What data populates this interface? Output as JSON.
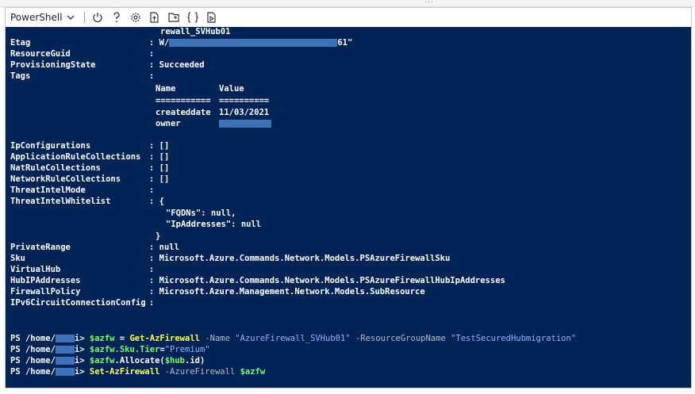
{
  "toolbar": {
    "shell": "PowerShell",
    "icons": [
      "chevron-down-icon",
      "power-icon",
      "help-icon",
      "gear-icon",
      "upload-download-icon",
      "open-editor-icon",
      "braces-icon",
      "web-preview-icon"
    ]
  },
  "console": {
    "prefix_line": "rewall_SVHub01",
    "props_top": [
      {
        "key": "Etag",
        "value": "W/",
        "value_tail": "61\""
      },
      {
        "key": "ResourceGuid",
        "value": ""
      },
      {
        "key": "ProvisioningState",
        "value": "Succeeded"
      },
      {
        "key": "Tags",
        "value": ""
      }
    ],
    "tags_table": {
      "headers": [
        "Name",
        "Value"
      ],
      "underline": [
        "===========",
        "=========="
      ],
      "rows": [
        {
          "name": "createddate",
          "value": "11/03/2021"
        },
        {
          "name": "owner",
          "value": ""
        }
      ]
    },
    "props_mid": [
      {
        "key": "IpConfigurations",
        "value": "[]"
      },
      {
        "key": "ApplicationRuleCollections",
        "value": "[]"
      },
      {
        "key": "NatRuleCollections",
        "value": "[]"
      },
      {
        "key": "NetworkRuleCollections",
        "value": "[]"
      },
      {
        "key": "ThreatIntelMode",
        "value": ""
      },
      {
        "key": "ThreatIntelWhitelist",
        "value": "{"
      }
    ],
    "json_block": [
      "\"FQDNs\": null,",
      "\"IpAddresses\": null",
      "}"
    ],
    "props_bottom": [
      {
        "key": "PrivateRange",
        "value": "null"
      },
      {
        "key": "Sku",
        "value": "Microsoft.Azure.Commands.Network.Models.PSAzureFirewallSku"
      },
      {
        "key": "VirtualHub",
        "value": ""
      },
      {
        "key": "HubIPAddresses",
        "value": "Microsoft.Azure.Commands.Network.Models.PSAzureFirewallHubIpAddresses"
      },
      {
        "key": "FirewallPolicy",
        "value": "Microsoft.Azure.Management.Network.Models.SubResource"
      },
      {
        "key": "IPv6CircuitConnectionConfig",
        "value": ""
      }
    ],
    "prompt": {
      "start": "PS /home/",
      "end": "i>"
    },
    "commands": [
      {
        "var": "$azfw",
        "eq": " = ",
        "cmd": "Get-AzFirewall",
        "p1": " -Name ",
        "s1": "\"AzureFirewall_SVHub01\"",
        "p2": " -ResourceGroupName ",
        "s2": "\"TestSecuredHubmigration\""
      },
      {
        "var": "$azfw.Sku.Tier",
        "eq": "=",
        "s1": "\"Premium\""
      },
      {
        "var": "$azfw",
        "rest": ".Allocate(",
        "var2": "$hub",
        "rest2": ".id)"
      },
      {
        "cmd": "Set-AzFirewall",
        "p1": " -AzureFirewall ",
        "var": "$azfw"
      }
    ]
  }
}
